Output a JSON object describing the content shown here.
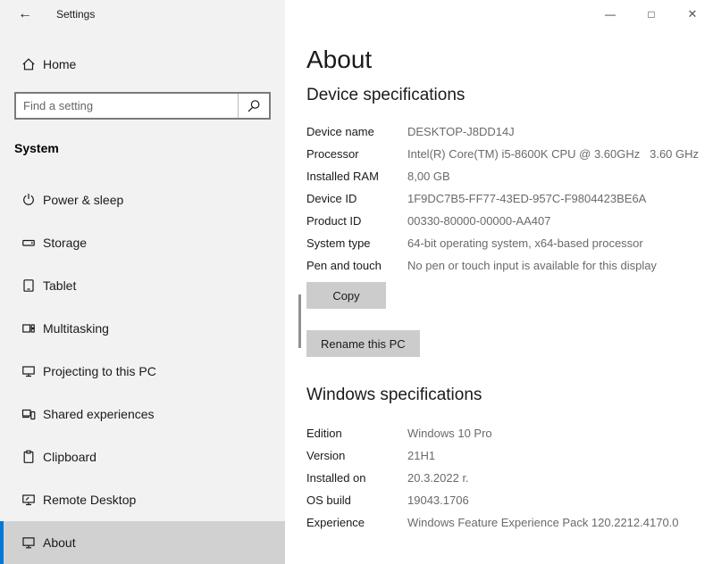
{
  "titlebar": {
    "back_glyph": "←",
    "app_title": "Settings",
    "controls": {
      "minimize": "—",
      "maximize": "□",
      "close": "✕"
    }
  },
  "sidebar": {
    "home_label": "Home",
    "search_placeholder": "Find a setting",
    "section_label": "System",
    "items": [
      {
        "label": "Power & sleep"
      },
      {
        "label": "Storage"
      },
      {
        "label": "Tablet"
      },
      {
        "label": "Multitasking"
      },
      {
        "label": "Projecting to this PC"
      },
      {
        "label": "Shared experiences"
      },
      {
        "label": "Clipboard"
      },
      {
        "label": "Remote Desktop"
      },
      {
        "label": "About",
        "selected": true
      }
    ]
  },
  "main": {
    "title": "About",
    "device_section": {
      "heading": "Device specifications",
      "rows": [
        {
          "label": "Device name",
          "value": "DESKTOP-J8DD14J"
        },
        {
          "label": "Processor",
          "value": "Intel(R) Core(TM) i5-8600K CPU @ 3.60GHz   3.60 GHz"
        },
        {
          "label": "Installed RAM",
          "value": "8,00 GB"
        },
        {
          "label": "Device ID",
          "value": "1F9DC7B5-FF77-43ED-957C-F9804423BE6A"
        },
        {
          "label": "Product ID",
          "value": "00330-80000-00000-AA407"
        },
        {
          "label": "System type",
          "value": "64-bit operating system, x64-based processor"
        },
        {
          "label": "Pen and touch",
          "value": "No pen or touch input is available for this display"
        }
      ],
      "copy_button": "Copy",
      "rename_button": "Rename this PC"
    },
    "windows_section": {
      "heading": "Windows specifications",
      "rows": [
        {
          "label": "Edition",
          "value": "Windows 10 Pro"
        },
        {
          "label": "Version",
          "value": "21H1"
        },
        {
          "label": "Installed on",
          "value": "20.3.2022 r."
        },
        {
          "label": "OS build",
          "value": "19043.1706"
        },
        {
          "label": "Experience",
          "value": "Windows Feature Experience Pack 120.2212.4170.0"
        }
      ]
    }
  },
  "colors": {
    "accent": "#0078d7",
    "sidebar_bg": "#f2f2f2",
    "selected_bg": "#d1d1d1",
    "button_bg": "#cccccc",
    "value_text": "#6a6a6a"
  }
}
